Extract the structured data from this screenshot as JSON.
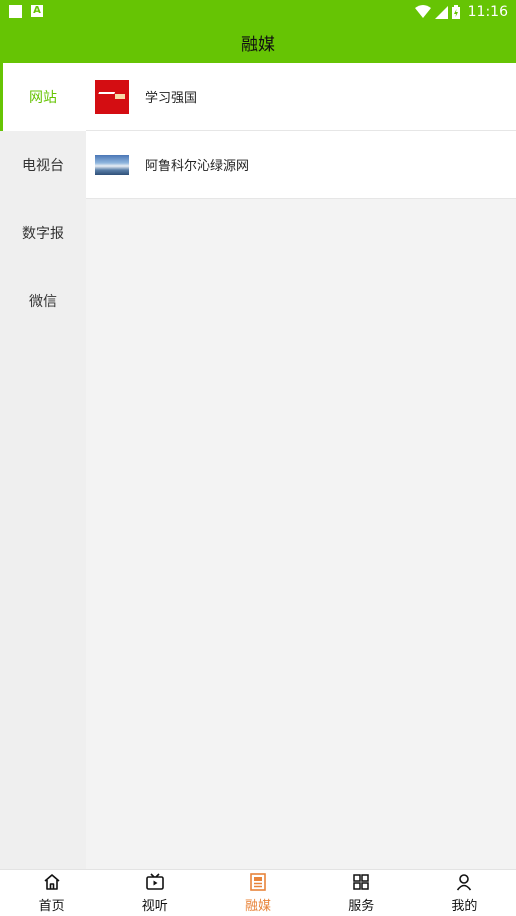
{
  "status_bar": {
    "time": "11:16",
    "icons": [
      "square-notification-icon",
      "a-notification-icon",
      "wifi-icon",
      "signal-icon",
      "battery-icon"
    ]
  },
  "header": {
    "title": "融媒"
  },
  "sidebar": {
    "items": [
      {
        "label": "网站",
        "active": true
      },
      {
        "label": "电视台",
        "active": false
      },
      {
        "label": "数字报",
        "active": false
      },
      {
        "label": "微信",
        "active": false
      }
    ]
  },
  "list": {
    "items": [
      {
        "label": "学习强国",
        "thumb": "xuexi-logo"
      },
      {
        "label": "阿鲁科尔沁绿源网",
        "thumb": "landscape-photo"
      }
    ]
  },
  "tabbar": {
    "tabs": [
      {
        "label": "首页",
        "icon": "home-icon",
        "active": false
      },
      {
        "label": "视听",
        "icon": "tv-play-icon",
        "active": false
      },
      {
        "label": "融媒",
        "icon": "newspaper-icon",
        "active": true
      },
      {
        "label": "服务",
        "icon": "grid-icon",
        "active": false
      },
      {
        "label": "我的",
        "icon": "user-icon",
        "active": false
      }
    ]
  },
  "colors": {
    "brand_green": "#66c404",
    "active_tab": "#e8843a",
    "sidebar_bg": "#efefef",
    "content_bg": "#f3f3f3"
  }
}
